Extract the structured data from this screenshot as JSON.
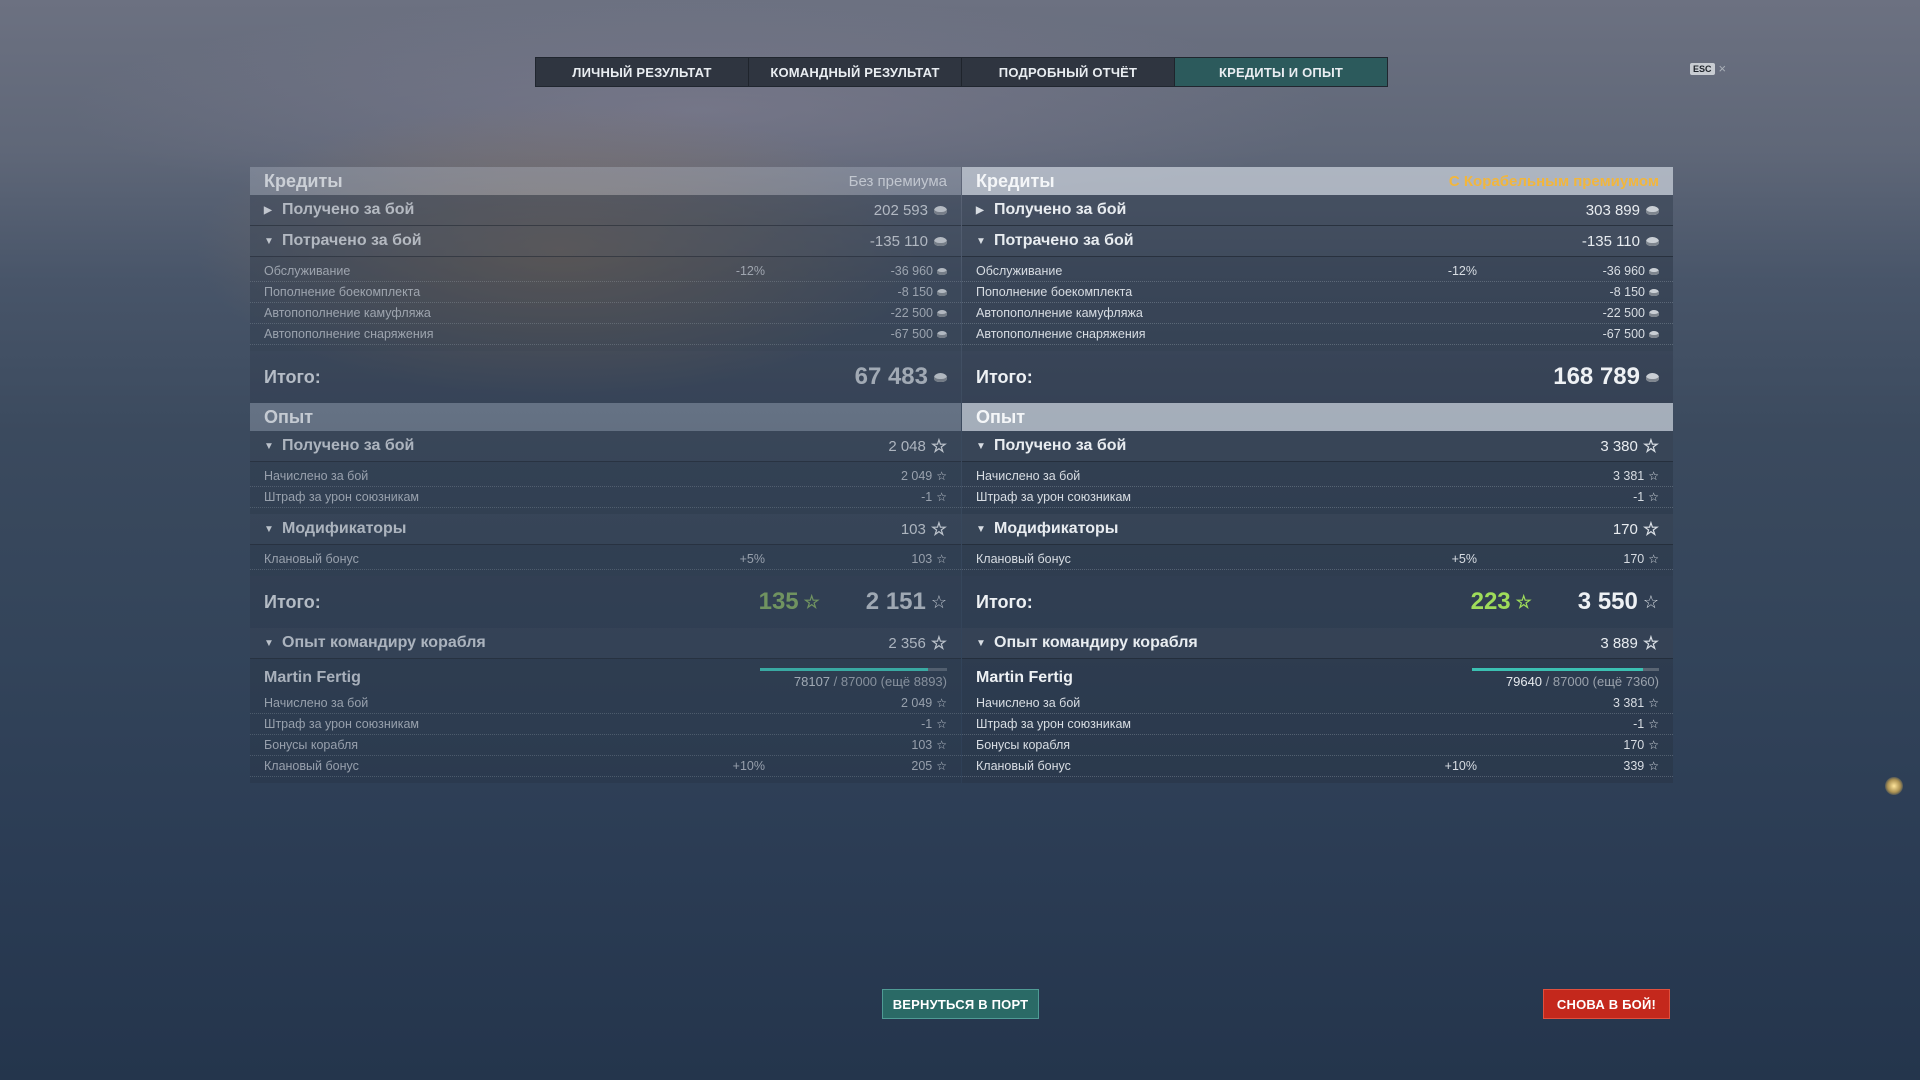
{
  "tabs": [
    {
      "label": "ЛИЧНЫЙ РЕЗУЛЬТАТ",
      "active": false
    },
    {
      "label": "КОМАНДНЫЙ РЕЗУЛЬТАТ",
      "active": false
    },
    {
      "label": "ПОДРОБНЫЙ ОТЧЁТ",
      "active": false
    },
    {
      "label": "КРЕДИТЫ И ОПЫТ",
      "active": true
    }
  ],
  "esc": {
    "key": "ESC",
    "close": "×"
  },
  "left": {
    "credits": {
      "title": "Кредиты",
      "note": "Без премиума",
      "received": {
        "label": "Получено за бой",
        "value": "202 593"
      },
      "spent": {
        "label": "Потрачено за бой",
        "value": "-135 110"
      },
      "details": [
        {
          "label": "Обслуживание",
          "pct": "-12%",
          "value": "-36 960"
        },
        {
          "label": "Пополнение боекомплекта",
          "pct": "",
          "value": "-8 150"
        },
        {
          "label": "Автопополнение камуфляжа",
          "pct": "",
          "value": "-22 500"
        },
        {
          "label": "Автопополнение снаряжения",
          "pct": "",
          "value": "-67 500"
        }
      ],
      "total_label": "Итого:",
      "total": "67 483"
    },
    "xp": {
      "title": "Опыт",
      "received": {
        "label": "Получено за бой",
        "value": "2 048"
      },
      "received_details": [
        {
          "label": "Начислено за бой",
          "pct": "",
          "value": "2 049"
        },
        {
          "label": "Штраф за урон союзникам",
          "pct": "",
          "value": "-1"
        }
      ],
      "modifiers": {
        "label": "Модификаторы",
        "value": "103"
      },
      "modifier_details": [
        {
          "label": "Клановый бонус",
          "pct": "+5%",
          "value": "103"
        }
      ],
      "total_label": "Итого:",
      "total_free": "135",
      "total": "2 151",
      "commander": {
        "label": "Опыт командиру корабля",
        "value": "2 356"
      },
      "commander_name": "Martin Fertig",
      "progress": {
        "current": "78107",
        "rest": "/ 87000 (ещё 8893)",
        "fraction": 0.898
      },
      "commander_details": [
        {
          "label": "Начислено за бой",
          "pct": "",
          "value": "2 049"
        },
        {
          "label": "Штраф за урон союзникам",
          "pct": "",
          "value": "-1"
        },
        {
          "label": "Бонусы корабля",
          "pct": "",
          "value": "103"
        },
        {
          "label": "Клановый бонус",
          "pct": "+10%",
          "value": "205"
        }
      ]
    }
  },
  "right": {
    "credits": {
      "title": "Кредиты",
      "note": "С Корабельным премиумом",
      "received": {
        "label": "Получено за бой",
        "value": "303 899"
      },
      "spent": {
        "label": "Потрачено за бой",
        "value": "-135 110"
      },
      "details": [
        {
          "label": "Обслуживание",
          "pct": "-12%",
          "value": "-36 960"
        },
        {
          "label": "Пополнение боекомплекта",
          "pct": "",
          "value": "-8 150"
        },
        {
          "label": "Автопополнение камуфляжа",
          "pct": "",
          "value": "-22 500"
        },
        {
          "label": "Автопополнение снаряжения",
          "pct": "",
          "value": "-67 500"
        }
      ],
      "total_label": "Итого:",
      "total": "168 789"
    },
    "xp": {
      "title": "Опыт",
      "received": {
        "label": "Получено за бой",
        "value": "3 380"
      },
      "received_details": [
        {
          "label": "Начислено за бой",
          "pct": "",
          "value": "3 381"
        },
        {
          "label": "Штраф за урон союзникам",
          "pct": "",
          "value": "-1"
        }
      ],
      "modifiers": {
        "label": "Модификаторы",
        "value": "170"
      },
      "modifier_details": [
        {
          "label": "Клановый бонус",
          "pct": "+5%",
          "value": "170"
        }
      ],
      "total_label": "Итого:",
      "total_free": "223",
      "total": "3 550",
      "commander": {
        "label": "Опыт командиру корабля",
        "value": "3 889"
      },
      "commander_name": "Martin Fertig",
      "progress": {
        "current": "79640",
        "rest": "/ 87000 (ещё 7360)",
        "fraction": 0.915
      },
      "commander_details": [
        {
          "label": "Начислено за бой",
          "pct": "",
          "value": "3 381"
        },
        {
          "label": "Штраф за урон союзникам",
          "pct": "",
          "value": "-1"
        },
        {
          "label": "Бонусы корабля",
          "pct": "",
          "value": "170"
        },
        {
          "label": "Клановый бонус",
          "pct": "+10%",
          "value": "339"
        }
      ]
    }
  },
  "buttons": {
    "port": "ВЕРНУТЬСЯ В ПОРТ",
    "battle": "СНОВА В БОЙ!"
  },
  "colors": {
    "active_tab": "#2c5a5c",
    "premium_note": "#f2b63c",
    "free_xp": "#9fdc5a",
    "battle_button": "#c4281c",
    "port_button": "#2a6a66"
  }
}
